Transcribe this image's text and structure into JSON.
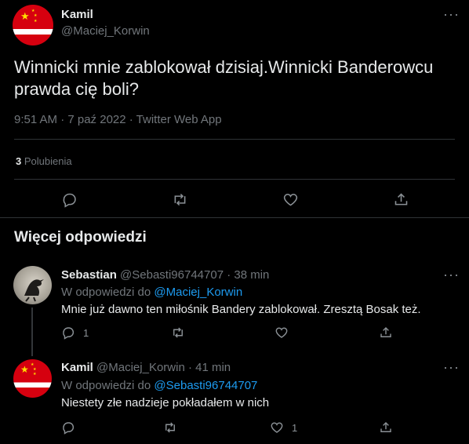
{
  "main_tweet": {
    "name": "Kamil",
    "handle": "@Maciej_Korwin",
    "text": "Winnicki mnie zablokował dzisiaj.Winnicki Banderowcu prawda cię boli?",
    "meta": "9:51 AM · 7 paź 2022 · Twitter Web App",
    "likes_count": "3",
    "likes_label": "Polubienia"
  },
  "section_title": "Więcej odpowiedzi",
  "replies": [
    {
      "name": "Sebastian",
      "handle": "@Sebasti96744707",
      "time": "· 38 min",
      "reply_to_label": "W odpowiedzi do",
      "reply_to_handle": "@Maciej_Korwin",
      "text": "Mnie już dawno ten miłośnik Bandery zablokował. Zresztą Bosak też.",
      "reply_count": "1",
      "like_count": ""
    },
    {
      "name": "Kamil",
      "handle": "@Maciej_Korwin",
      "time": "· 41 min",
      "reply_to_label": "W odpowiedzi do",
      "reply_to_handle": "@Sebasti96744707",
      "text": "Niestety złe nadzieje pokładałem w nich",
      "reply_count": "",
      "like_count": "1"
    }
  ],
  "icons": {
    "more": "more-horizontal-icon",
    "reply": "reply-bubble-icon",
    "retweet": "retweet-icon",
    "like": "heart-icon",
    "share": "share-icon"
  },
  "more_glyph": "···",
  "colors": {
    "background": "#000000",
    "text": "#e7e9ea",
    "muted": "#71767b",
    "link": "#1d9bf0",
    "divider": "#2f3336"
  }
}
